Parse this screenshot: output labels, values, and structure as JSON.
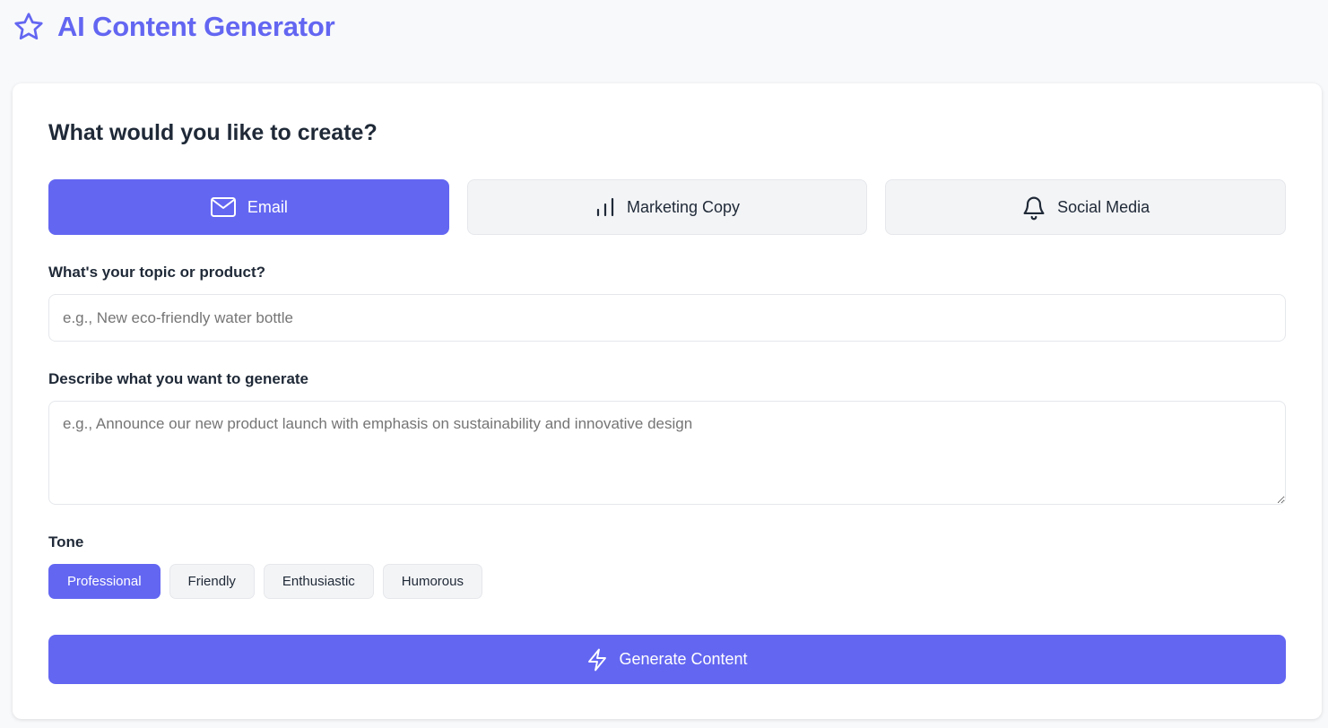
{
  "header": {
    "title": "AI Content Generator",
    "logo_icon": "star-icon"
  },
  "form": {
    "section_title": "What would you like to create?",
    "content_types": [
      {
        "label": "Email",
        "icon": "mail-icon",
        "selected": true
      },
      {
        "label": "Marketing Copy",
        "icon": "bar-chart-icon",
        "selected": false
      },
      {
        "label": "Social Media",
        "icon": "bell-icon",
        "selected": false
      }
    ],
    "topic": {
      "label": "What's your topic or product?",
      "value": "",
      "placeholder": "e.g., New eco-friendly water bottle"
    },
    "description": {
      "label": "Describe what you want to generate",
      "value": "",
      "placeholder": "e.g., Announce our new product launch with emphasis on sustainability and innovative design"
    },
    "tone": {
      "label": "Tone",
      "options": [
        {
          "label": "Professional",
          "selected": true
        },
        {
          "label": "Friendly",
          "selected": false
        },
        {
          "label": "Enthusiastic",
          "selected": false
        },
        {
          "label": "Humorous",
          "selected": false
        }
      ]
    },
    "generate_label": "Generate Content",
    "generate_icon": "lightning-icon"
  },
  "colors": {
    "accent": "#6366f1",
    "background": "#f8f9fb",
    "card": "#ffffff",
    "inactive_button": "#f3f4f6",
    "text": "#1f2937"
  }
}
